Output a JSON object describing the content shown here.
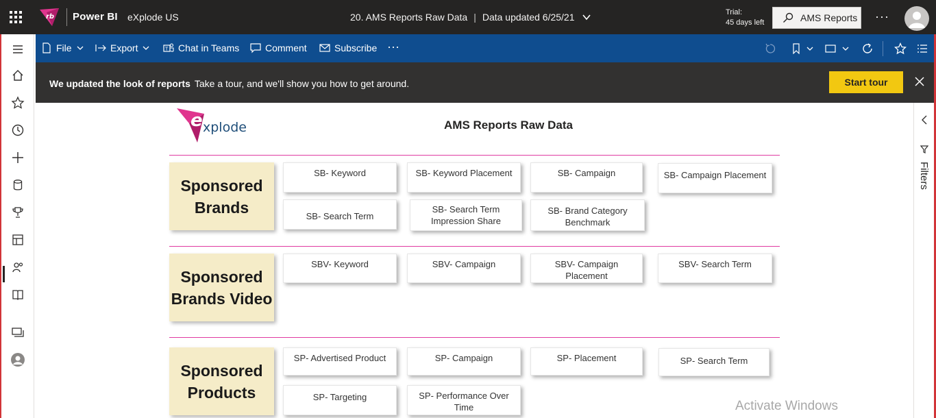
{
  "header": {
    "app_logo_text": "rb",
    "app_name": "Power BI",
    "workspace": "eXplode US",
    "report_name": "20. AMS Reports Raw Data",
    "data_updated": "Data updated 6/25/21",
    "trial_line1": "Trial:",
    "trial_line2": "45 days left",
    "search_label": "AMS Reports"
  },
  "actionbar": {
    "file": "File",
    "export": "Export",
    "chat_in_teams": "Chat in Teams",
    "comment": "Comment",
    "subscribe": "Subscribe"
  },
  "banner": {
    "bold": "We updated the look of reports",
    "text": "Take a tour, and we'll show you how to get around.",
    "button": "Start tour"
  },
  "right_pane": {
    "filters": "Filters"
  },
  "report": {
    "logo_text": "xplode",
    "title": "AMS Reports Raw Data",
    "sections": [
      {
        "line1": "Sponsored",
        "line2": "Brands",
        "tiles": [
          "SB- Keyword",
          "SB- Keyword Placement",
          "SB- Campaign",
          "SB- Campaign Placement",
          "SB- Search Term",
          "SB- Search Term Impression Share",
          "SB- Brand Category Benchmark"
        ]
      },
      {
        "line1": "Sponsored",
        "line2": "Brands Video",
        "tiles": [
          "SBV- Keyword",
          "SBV- Campaign",
          "SBV- Campaign Placement",
          "SBV- Search Term"
        ]
      },
      {
        "line1": "Sponsored",
        "line2": "Products",
        "tiles": [
          "SP- Advertised Product",
          "SP- Campaign",
          "SP- Placement",
          "SP- Search Term",
          "SP- Targeting",
          "SP- Performance Over Time"
        ]
      }
    ]
  },
  "watermark": "Activate Windows",
  "colors": {
    "header_bg": "#252423",
    "actionbar_bg": "#0f4d8f",
    "banner_bg": "#323130",
    "start_tour": "#f2c811",
    "section_box": "#f5ecc8",
    "rule": "#e03aa1",
    "frame": "#d13438"
  }
}
